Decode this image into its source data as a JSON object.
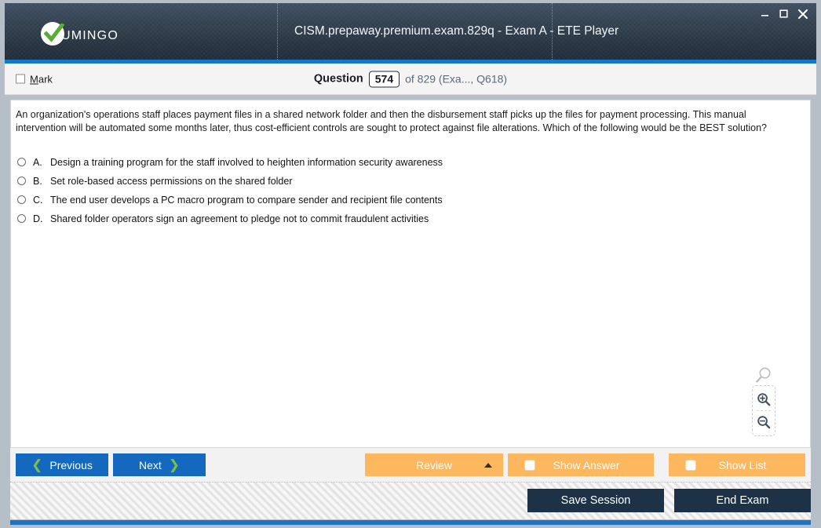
{
  "window": {
    "title": "CISM.prepaway.premium.exam.829q - Exam A - ETE Player",
    "logo_text": "UMINGO",
    "controls": {
      "minimize": "minimize-icon",
      "maximize": "maximize-icon",
      "close": "close-icon"
    },
    "colors": {
      "titlebar_dark": "#25323f",
      "accent_blue": "#1477cc",
      "button_blue": "#1469be",
      "button_orange": "#fdb85f",
      "button_navy": "#1e3247",
      "chevron_green": "#7dc242",
      "check_green": "#5aab31"
    }
  },
  "question_bar": {
    "mark_label_prefix": "M",
    "mark_label_rest": "ark",
    "mark_checked": false,
    "question_label": "Question",
    "question_number": "574",
    "suffix": "of 829 (Exa..., Q618)"
  },
  "question": {
    "text": "An organization's operations staff places payment files in a shared network folder and then the disbursement staff picks up the files for payment processing. This manual intervention will be automated some months later, thus cost-efficient controls are sought to protect against file alterations. Which of the following would be the BEST solution?",
    "options": [
      {
        "letter": "A.",
        "text": "Design a training program for the staff involved to heighten information security awareness",
        "selected": false
      },
      {
        "letter": "B.",
        "text": "Set role-based access permissions on the shared folder",
        "selected": false
      },
      {
        "letter": "C.",
        "text": "The end user develops a PC macro program to compare sender and recipient file contents",
        "selected": false
      },
      {
        "letter": "D.",
        "text": "Shared folder operators sign an agreement to pledge not to commit fraudulent activities",
        "selected": false
      }
    ]
  },
  "zoom_controls": {
    "ghost": "magnifier-icon",
    "zoom_in": "zoom-in-icon",
    "zoom_out": "zoom-out-icon"
  },
  "toolbar": {
    "previous_label": "Previous",
    "next_label": "Next",
    "review_label": "Review",
    "show_answer_label": "Show Answer",
    "show_list_label": "Show List"
  },
  "statusbar": {
    "save_session_label": "Save Session",
    "end_exam_label": "End Exam"
  }
}
